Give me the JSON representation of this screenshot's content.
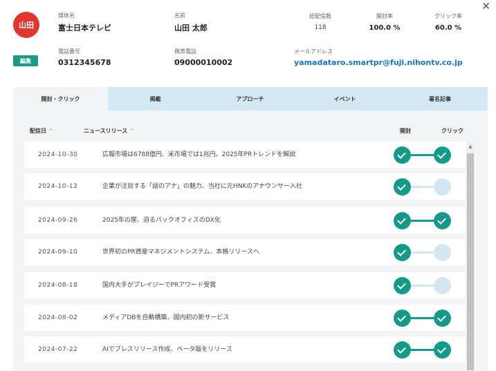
{
  "dialog": {
    "close_icon": "✕"
  },
  "profile": {
    "avatar_text": "山田",
    "edit_label": "編集",
    "media_label": "媒体名",
    "media_value": "富士日本テレビ",
    "name_label": "名前",
    "name_value": "山田 太郎",
    "phone_label": "電話番号",
    "phone_value": "0312345678",
    "mobile_label": "携帯電話",
    "mobile_value": "09000010002",
    "email_label": "メールアドレス",
    "email_value": "yamadataro.smartpr@fuji.nihontv.co.jp"
  },
  "stats": {
    "total_label": "総配信数",
    "total_value": "118",
    "open_label": "開封率",
    "open_value": "100.0 %",
    "click_label": "クリック率",
    "click_value": "60.0 %"
  },
  "tabs": [
    {
      "label": "開封・クリック",
      "active": true
    },
    {
      "label": "掲載",
      "active": false
    },
    {
      "label": "アプローチ",
      "active": false
    },
    {
      "label": "イベント",
      "active": false
    },
    {
      "label": "署名記事",
      "active": false
    }
  ],
  "table": {
    "col_date": "配信日",
    "col_release": "ニュースリリース",
    "col_open": "開封",
    "col_click": "クリック",
    "sort_caret": "^",
    "rows": [
      {
        "date": "2024-10-30",
        "title": "広報市場は6788億円、米市場では1兆円。2025年PRトレンドを解説",
        "opened": true,
        "clicked": true
      },
      {
        "date": "2024-10-12",
        "title": "企業が注目する「話のアナ」の魅力、当社に元HNKのアナウンサー入社",
        "opened": true,
        "clicked": false
      },
      {
        "date": "2024-09-26",
        "title": "2025年の崖、迫るバックオフィスのDX化",
        "opened": true,
        "clicked": true
      },
      {
        "date": "2024-09-10",
        "title": "世界初のPR資産マネジメントシステム、本格リリースへ",
        "opened": true,
        "clicked": false
      },
      {
        "date": "2024-08-18",
        "title": "国内大手がプレイジーでPRアワード受賞",
        "opened": true,
        "clicked": false
      },
      {
        "date": "2024-08-02",
        "title": "メディアDBを自動構築、国内初の新サービス",
        "opened": true,
        "clicked": true
      },
      {
        "date": "2024-07-22",
        "title": "AIでプレスリリース作成、ベータ版をリリース",
        "opened": true,
        "clicked": true
      }
    ]
  },
  "colors": {
    "accent": "#149a88",
    "avatar": "#e3342f",
    "inactive": "#d4e6f1",
    "link": "#1a73c8"
  }
}
